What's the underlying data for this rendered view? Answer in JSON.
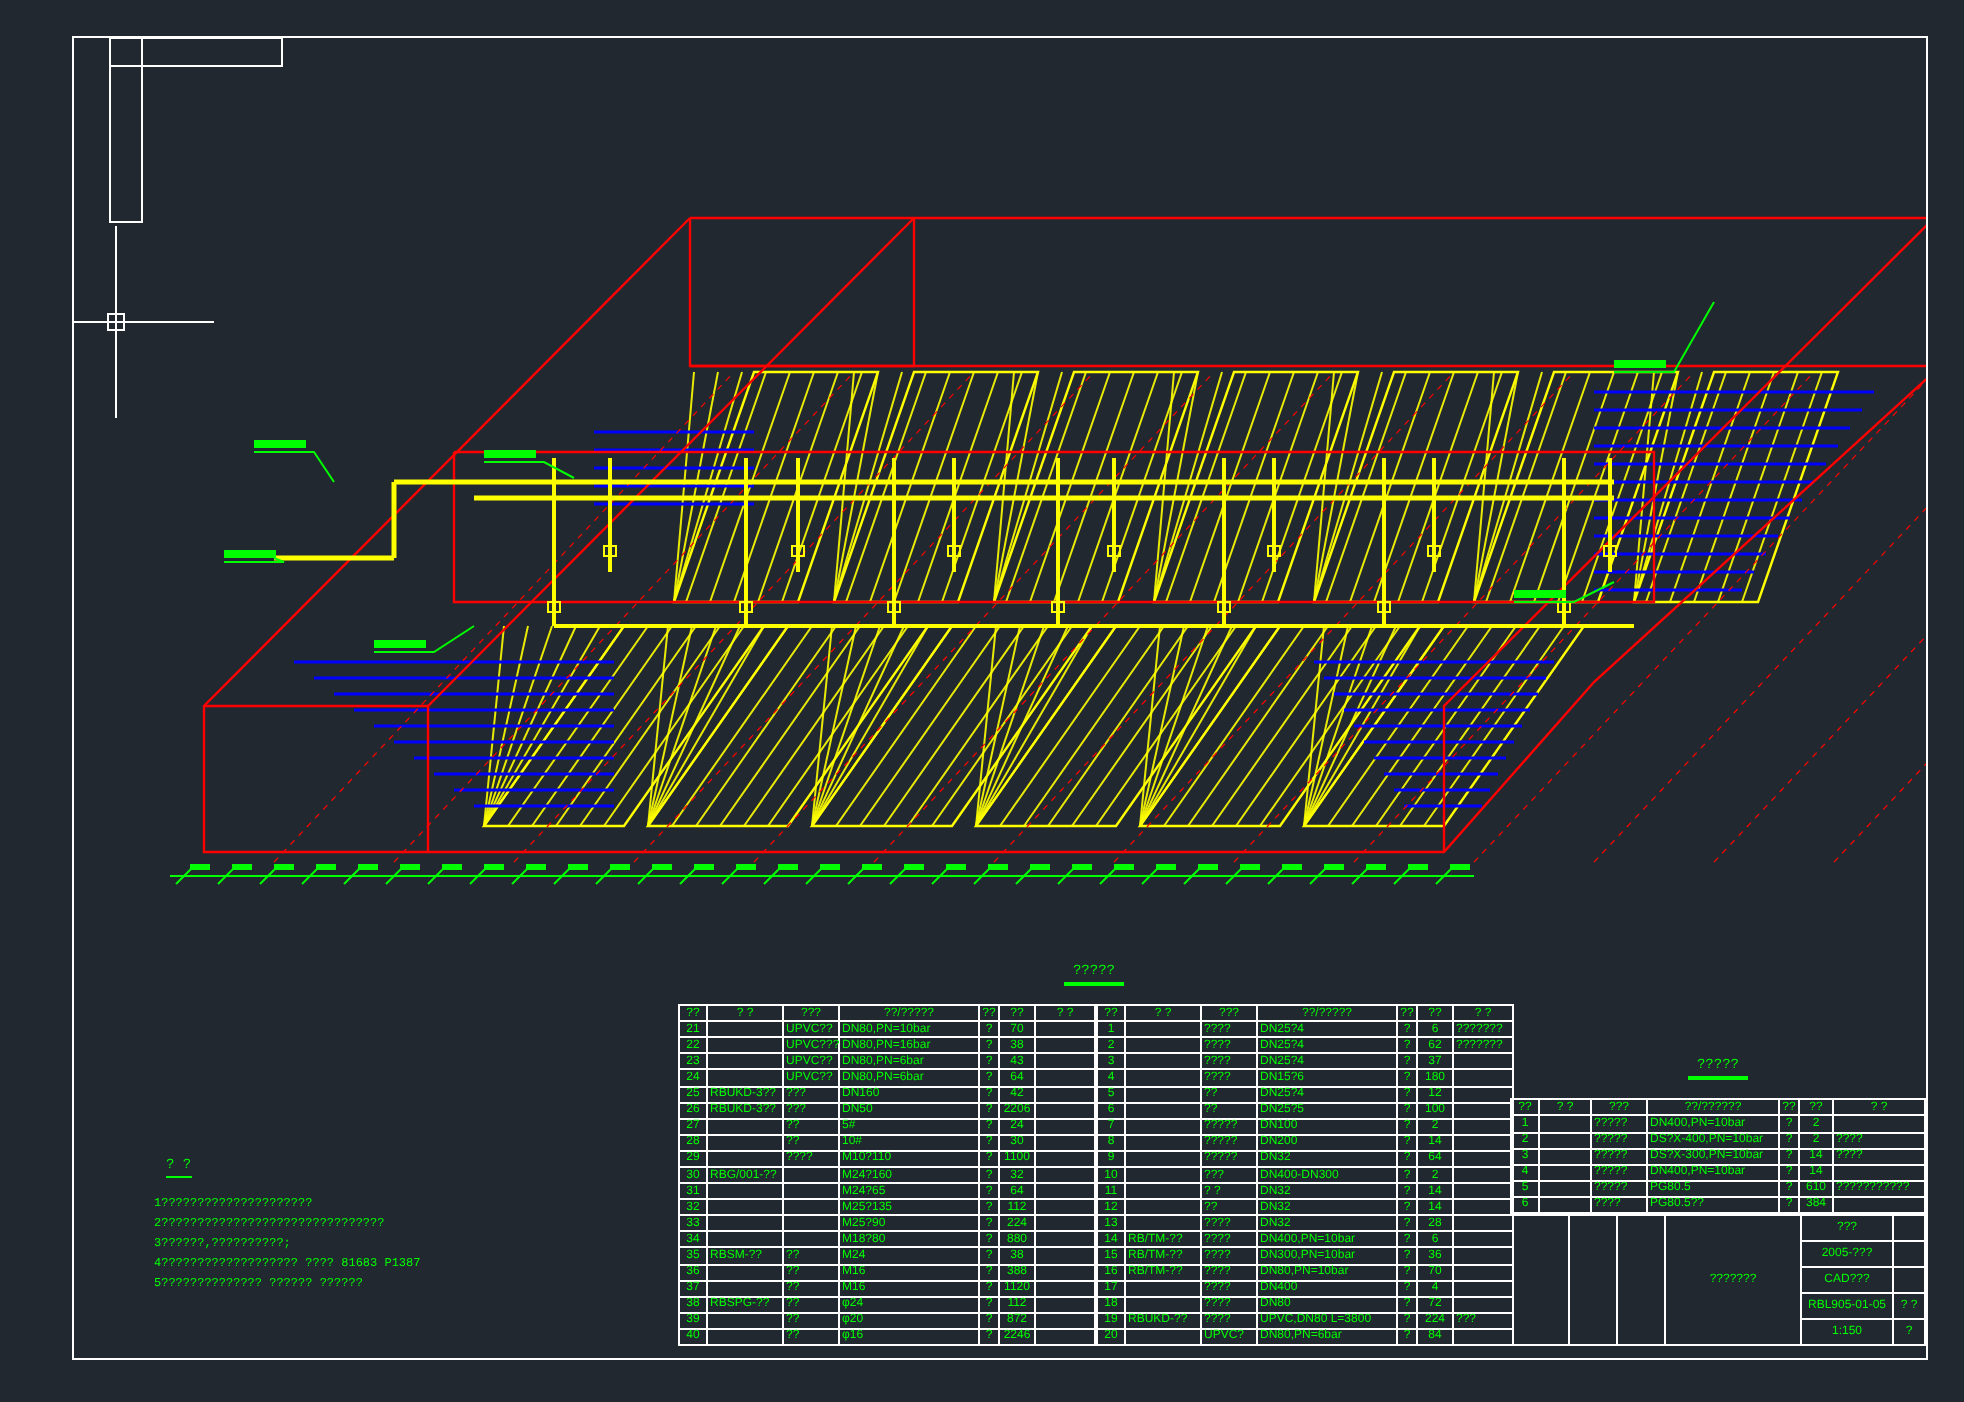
{
  "notes": {
    "title": "? ?",
    "lines": [
      "1?????????????????????",
      "2???????????????????????????????",
      "3??????,??????????;",
      "4??????????????????? ???? 81683 P1387",
      "5?????????????? ?????? ??????"
    ]
  },
  "bill": {
    "title": "?????",
    "columns": [
      "??",
      "? ?",
      "???",
      "??/?????",
      "??",
      "??",
      "?      ?"
    ],
    "left_rows": [
      [
        "21",
        "",
        "UPVC??",
        "DN80,PN=10bar",
        "?",
        "70",
        ""
      ],
      [
        "22",
        "",
        "UPVC???",
        "DN80,PN=16bar",
        "?",
        "38",
        ""
      ],
      [
        "23",
        "",
        "UPVC??",
        "DN80,PN=6bar",
        "?",
        "43",
        ""
      ],
      [
        "24",
        "",
        "UPVC??",
        "DN80,PN=6bar",
        "?",
        "64",
        ""
      ],
      [
        "25",
        "RBUKD-3??",
        "???",
        "DN160",
        "?",
        "42",
        ""
      ],
      [
        "26",
        "RBUKD-3??",
        "???",
        "DN50",
        "?",
        "2206",
        ""
      ],
      [
        "27",
        "",
        "??",
        "5#",
        "?",
        "24",
        ""
      ],
      [
        "28",
        "",
        "??",
        "10#",
        "?",
        "30",
        ""
      ],
      [
        "29",
        "",
        "????",
        "M10?110",
        "?",
        "1100",
        ""
      ],
      [
        "30",
        "RBG/001-??",
        "",
        "M24?160",
        "?",
        "32",
        ""
      ],
      [
        "31",
        "",
        "",
        "M24?65",
        "?",
        "64",
        ""
      ],
      [
        "32",
        "",
        "",
        "M25?135",
        "?",
        "112",
        ""
      ],
      [
        "33",
        "",
        "",
        "M25?90",
        "?",
        "224",
        ""
      ],
      [
        "34",
        "",
        "",
        "M18?80",
        "?",
        "880",
        ""
      ],
      [
        "35",
        "RBSM-??",
        "??",
        "M24",
        "?",
        "38",
        ""
      ],
      [
        "36",
        "",
        "??",
        "M16",
        "?",
        "388",
        ""
      ],
      [
        "37",
        "",
        "??",
        "M16",
        "?",
        "1120",
        ""
      ],
      [
        "38",
        "RBSPG-??",
        "??",
        "φ24",
        "?",
        "112",
        ""
      ],
      [
        "39",
        "",
        "??",
        "φ20",
        "?",
        "872",
        ""
      ],
      [
        "40",
        "",
        "??",
        "φ16",
        "?",
        "2246",
        ""
      ]
    ],
    "right_rows": [
      [
        "1",
        "",
        "????",
        "DN25?4",
        "?",
        "6",
        "???????"
      ],
      [
        "2",
        "",
        "????",
        "DN25?4",
        "?",
        "62",
        "???????"
      ],
      [
        "3",
        "",
        "????",
        "DN25?4",
        "?",
        "37",
        ""
      ],
      [
        "4",
        "",
        "????",
        "DN15?6",
        "?",
        "180",
        ""
      ],
      [
        "5",
        "",
        "??",
        "DN25?4",
        "?",
        "12",
        ""
      ],
      [
        "6",
        "",
        "??",
        "DN25?5",
        "?",
        "100",
        ""
      ],
      [
        "7",
        "",
        "?????",
        "DN100",
        "?",
        "2",
        ""
      ],
      [
        "8",
        "",
        "?????",
        "DN200",
        "?",
        "14",
        ""
      ],
      [
        "9",
        "",
        "?????",
        "DN32",
        "?",
        "64",
        ""
      ],
      [
        "10",
        "",
        "???",
        "DN400-DN300",
        "?",
        "2",
        ""
      ],
      [
        "11",
        "",
        "? ?",
        "DN32",
        "?",
        "14",
        ""
      ],
      [
        "12",
        "",
        "??",
        "DN32",
        "?",
        "14",
        ""
      ],
      [
        "13",
        "",
        "????",
        "DN32",
        "?",
        "28",
        ""
      ],
      [
        "14",
        "RB/TM-??",
        "????",
        "DN400,PN=10bar",
        "?",
        "6",
        ""
      ],
      [
        "15",
        "RB/TM-??",
        "????",
        "DN300,PN=10bar",
        "?",
        "36",
        ""
      ],
      [
        "16",
        "RB/TM-??",
        "????",
        "DN80,PN=10bar",
        "?",
        "70",
        ""
      ],
      [
        "17",
        "",
        "????",
        "DN400",
        "?",
        "4",
        ""
      ],
      [
        "18",
        "",
        "????",
        "DN80",
        "?",
        "72",
        ""
      ],
      [
        "19",
        "RBUKD-??",
        "????",
        "UPVC,DN80 L=3800",
        "?",
        "224",
        "???"
      ],
      [
        "20",
        "",
        "UPVC?",
        "DN80,PN=6bar",
        "?",
        "84",
        ""
      ]
    ]
  },
  "parts": {
    "title": "?????",
    "columns": [
      "??",
      "? ?",
      "???",
      "??/??????",
      "??",
      "??",
      "?  ?"
    ],
    "rows": [
      [
        "1",
        "",
        "?????",
        "DN400,PN=10bar",
        "?",
        "2",
        ""
      ],
      [
        "2",
        "",
        "?????",
        "DS?X-400,PN=10bar",
        "?",
        "2",
        "????"
      ],
      [
        "3",
        "",
        "?????",
        "DS?X-300,PN=10bar",
        "?",
        "14",
        "????"
      ],
      [
        "4",
        "",
        "?????",
        "DN400,PN=10bar",
        "?",
        "14",
        ""
      ],
      [
        "5",
        "",
        "?????",
        "PG80.5",
        "?",
        "610",
        "???????????"
      ],
      [
        "6",
        "",
        "????",
        "PG80.5??",
        "?",
        "384",
        ""
      ]
    ]
  },
  "title_block": {
    "drawing_name": "???????",
    "date": "2005-???",
    "software": "CAD???",
    "number": "RBL905-01-05",
    "scale": "1:150",
    "sheet": "?",
    "scale_label": "? ?",
    "stage": "???"
  }
}
